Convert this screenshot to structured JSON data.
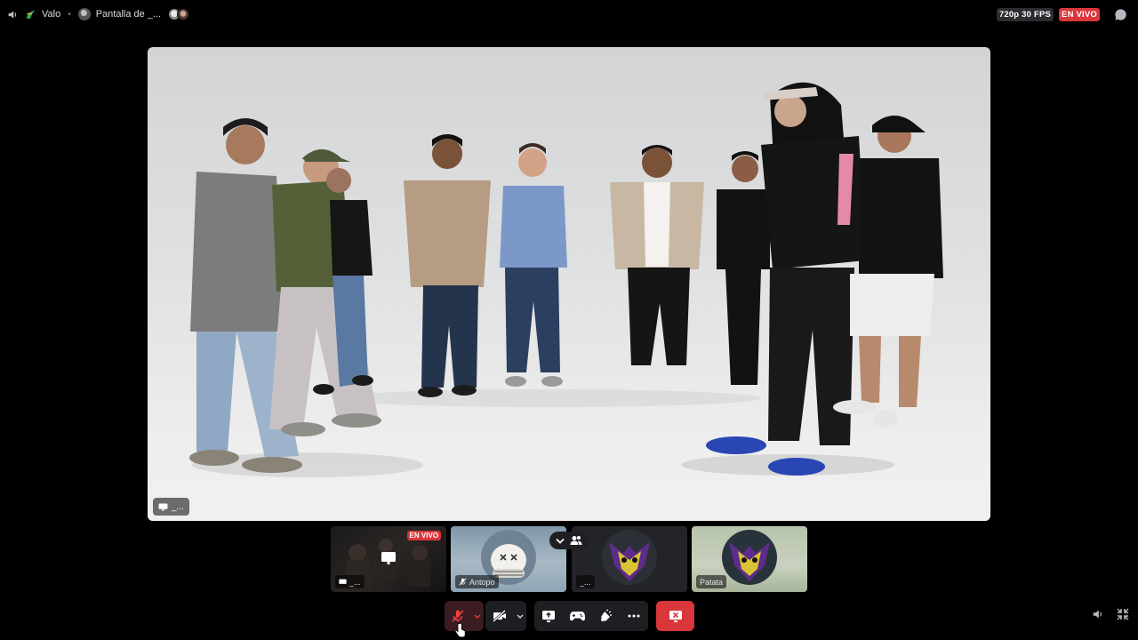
{
  "topbar": {
    "volume_icon": "speaker-icon",
    "channel_name": "Valo",
    "stream_title": "Pantalla de _...",
    "quality": "720p 30 FPS",
    "live_label": "EN VIVO"
  },
  "stage": {
    "label": "_..."
  },
  "thumbnails": [
    {
      "label": "_...",
      "live_badge": "EN VIVO",
      "kind": "stream"
    },
    {
      "label": "Antopo",
      "kind": "avatar",
      "muted": true
    },
    {
      "label": "_...",
      "kind": "avatar"
    },
    {
      "label": "Patata",
      "kind": "avatar"
    }
  ],
  "colors": {
    "live_red": "#da373c",
    "panel": "#1e1f22",
    "background": "#000000"
  },
  "controls": {
    "mic": "mic-muted-icon",
    "camera": "camera-off-icon",
    "share_screen": "share-screen-icon",
    "activities": "gamepad-icon",
    "soundboard": "soundboard-icon",
    "more": "more-icon",
    "disconnect": "end-call-icon"
  }
}
